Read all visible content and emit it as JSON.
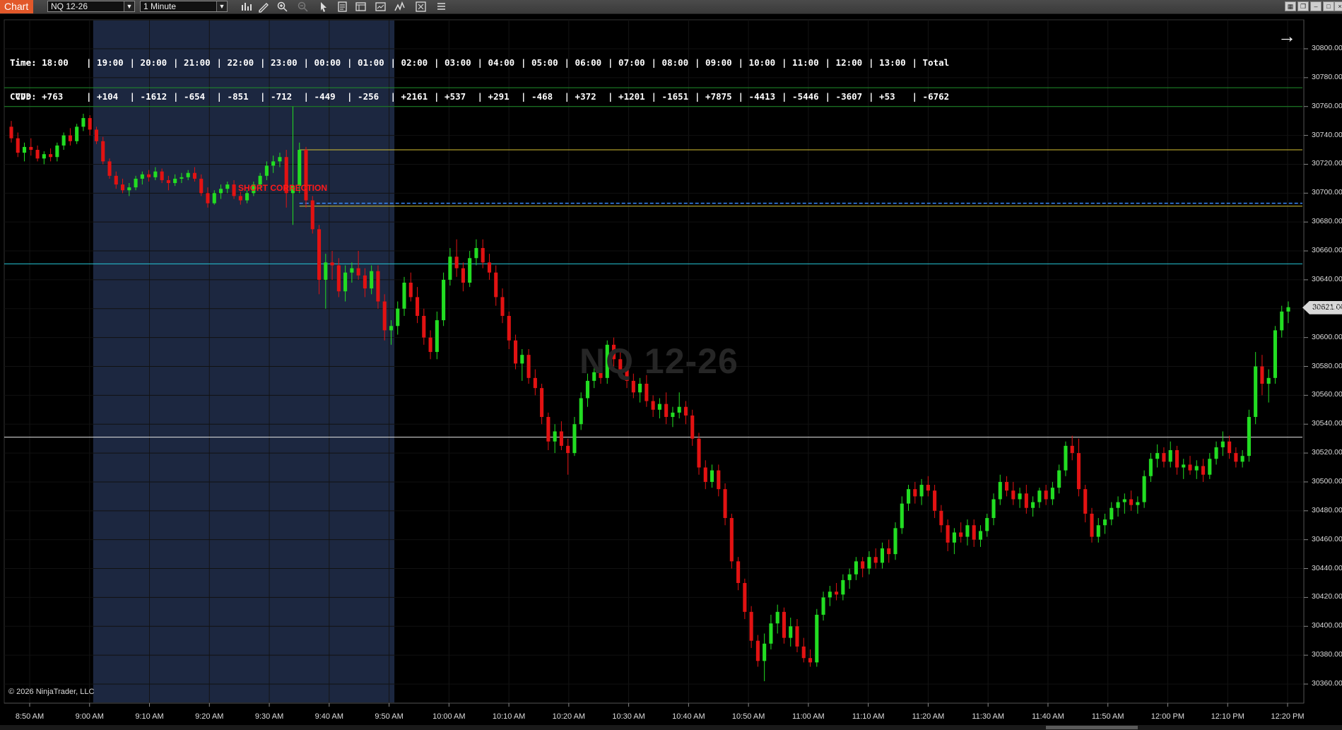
{
  "toolbar": {
    "tab_label": "Chart",
    "instrument": "NQ 12-26",
    "interval": "1 Minute",
    "icons": [
      "bar-type-icon",
      "pencil-icon",
      "zoom-in-icon",
      "zoom-out-icon",
      "pointer-icon",
      "data-box-icon",
      "properties-icon",
      "strategy-icon",
      "indicator-icon",
      "templates-icon",
      "menu-icon"
    ],
    "window_buttons": [
      "tile-icon",
      "restore-icon",
      "minimize-icon",
      "maximize-icon",
      "close-icon"
    ]
  },
  "cvd_table": {
    "time_label": "Time:",
    "cvd_label": "CVD:",
    "times": [
      "18:00",
      "19:00",
      "20:00",
      "21:00",
      "22:00",
      "23:00",
      "00:00",
      "01:00",
      "02:00",
      "03:00",
      "04:00",
      "05:00",
      "06:00",
      "07:00",
      "08:00",
      "09:00",
      "10:00",
      "11:00",
      "12:00",
      "13:00",
      "Total"
    ],
    "values": [
      "+763",
      "+104",
      "-1612",
      "-654",
      "-851",
      "-712",
      "-449",
      "-256",
      "+2161",
      "+537",
      "+291",
      "-468",
      "+372",
      "+1201",
      "-1651",
      "+7875",
      "-4413",
      "-5446",
      "-3607",
      "+53",
      "-6762"
    ]
  },
  "watermark": "NQ 12-26",
  "signal_label": "SHORT CORRECTION",
  "copyright": "© 2026 NinjaTrader, LLC",
  "last_price": "30621.00",
  "colors": {
    "up": "#22dd22",
    "down": "#e21212",
    "session_shade": "#1c2740",
    "bg": "#000000"
  },
  "chart_data": {
    "type": "candlestick",
    "instrument": "NQ 12-26",
    "interval": "1 Minute",
    "ylim": [
      30350,
      30810
    ],
    "y_ticks": [
      "30800.00",
      "30780.00",
      "30760.00",
      "30740.00",
      "30720.00",
      "30700.00",
      "30680.00",
      "30660.00",
      "30640.00",
      "30620.00",
      "30600.00",
      "30580.00",
      "30560.00",
      "30540.00",
      "30520.00",
      "30500.00",
      "30480.00",
      "30460.00",
      "30440.00",
      "30420.00",
      "30400.00",
      "30380.00",
      "30360.00"
    ],
    "x_ticks": [
      "8:50 AM",
      "9:00 AM",
      "9:10 AM",
      "9:20 AM",
      "9:30 AM",
      "9:40 AM",
      "9:50 AM",
      "10:00 AM",
      "10:10 AM",
      "10:20 AM",
      "10:30 AM",
      "10:40 AM",
      "10:50 AM",
      "11:00 AM",
      "11:10 AM",
      "11:20 AM",
      "11:30 AM",
      "11:40 AM",
      "11:50 AM",
      "12:00 PM",
      "12:10 PM",
      "12:20 PM"
    ],
    "horizontal_lines": [
      {
        "price": 30773,
        "color": "#1f8f2a",
        "style": "solid"
      },
      {
        "price": 30760,
        "color": "#1f8f2a",
        "style": "solid"
      },
      {
        "price": 30730,
        "color": "#d6c234",
        "style": "solid"
      },
      {
        "price": 30693,
        "color": "#3a8cff",
        "style": "dashed"
      },
      {
        "price": 30691,
        "color": "#d6c234",
        "style": "solid"
      },
      {
        "price": 30651,
        "color": "#26c6d6",
        "style": "solid"
      },
      {
        "price": 30531,
        "color": "#e6e6e6",
        "style": "solid"
      }
    ],
    "session_shade": {
      "from_bar": 13,
      "to_bar": 58
    },
    "candles": [
      [
        30746,
        30750,
        30735,
        30738
      ],
      [
        30738,
        30742,
        30725,
        30728
      ],
      [
        30728,
        30735,
        30722,
        30732
      ],
      [
        30732,
        30738,
        30726,
        30730
      ],
      [
        30730,
        30733,
        30722,
        30724
      ],
      [
        30724,
        30729,
        30720,
        30727
      ],
      [
        30727,
        30731,
        30722,
        30725
      ],
      [
        30725,
        30735,
        30722,
        30733
      ],
      [
        30733,
        30742,
        30730,
        30740
      ],
      [
        30740,
        30745,
        30733,
        30736
      ],
      [
        30736,
        30748,
        30734,
        30746
      ],
      [
        30746,
        30755,
        30743,
        30752
      ],
      [
        30752,
        30754,
        30740,
        30744
      ],
      [
        30744,
        30746,
        30734,
        30736
      ],
      [
        30736,
        30739,
        30720,
        30722
      ],
      [
        30722,
        30724,
        30710,
        30712
      ],
      [
        30712,
        30715,
        30703,
        30706
      ],
      [
        30706,
        30710,
        30700,
        30702
      ],
      [
        30702,
        30707,
        30698,
        30704
      ],
      [
        30704,
        30712,
        30702,
        30710
      ],
      [
        30710,
        30715,
        30706,
        30713
      ],
      [
        30713,
        30716,
        30708,
        30711
      ],
      [
        30711,
        30718,
        30709,
        30715
      ],
      [
        30715,
        30717,
        30707,
        30709
      ],
      [
        30709,
        30712,
        30702,
        30707
      ],
      [
        30707,
        30713,
        30705,
        30710
      ],
      [
        30710,
        30714,
        30707,
        30711
      ],
      [
        30711,
        30716,
        30709,
        30714
      ],
      [
        30714,
        30718,
        30708,
        30710
      ],
      [
        30710,
        30713,
        30698,
        30700
      ],
      [
        30700,
        30704,
        30690,
        30693
      ],
      [
        30693,
        30702,
        30692,
        30700
      ],
      [
        30700,
        30706,
        30696,
        30703
      ],
      [
        30703,
        30708,
        30700,
        30706
      ],
      [
        30706,
        30709,
        30696,
        30698
      ],
      [
        30698,
        30701,
        30692,
        30695
      ],
      [
        30695,
        30702,
        30693,
        30700
      ],
      [
        30700,
        30708,
        30698,
        30706
      ],
      [
        30706,
        30714,
        30703,
        30712
      ],
      [
        30712,
        30722,
        30709,
        30719
      ],
      [
        30719,
        30726,
        30714,
        30722
      ],
      [
        30722,
        30728,
        30718,
        30725
      ],
      [
        30725,
        30730,
        30690,
        30700
      ],
      [
        30700,
        30760,
        30678,
        30705
      ],
      [
        30705,
        30735,
        30700,
        30730
      ],
      [
        30730,
        30732,
        30690,
        30695
      ],
      [
        30695,
        30698,
        30672,
        30675
      ],
      [
        30675,
        30678,
        30630,
        30640
      ],
      [
        30640,
        30658,
        30620,
        30652
      ],
      [
        30652,
        30660,
        30640,
        30650
      ],
      [
        30650,
        30655,
        30628,
        30632
      ],
      [
        30632,
        30650,
        30625,
        30645
      ],
      [
        30645,
        30652,
        30638,
        30648
      ],
      [
        30648,
        30660,
        30640,
        30643
      ],
      [
        30643,
        30648,
        30628,
        30634
      ],
      [
        30634,
        30650,
        30630,
        30646
      ],
      [
        30646,
        30650,
        30620,
        30625
      ],
      [
        30625,
        30630,
        30598,
        30605
      ],
      [
        30605,
        30612,
        30595,
        30608
      ],
      [
        30608,
        30625,
        30602,
        30620
      ],
      [
        30620,
        30642,
        30615,
        30638
      ],
      [
        30638,
        30645,
        30625,
        30628
      ],
      [
        30628,
        30635,
        30610,
        30615
      ],
      [
        30615,
        30620,
        30595,
        30600
      ],
      [
        30600,
        30605,
        30585,
        30590
      ],
      [
        30590,
        30618,
        30585,
        30612
      ],
      [
        30612,
        30645,
        30608,
        30640
      ],
      [
        30640,
        30662,
        30636,
        30656
      ],
      [
        30656,
        30668,
        30642,
        30648
      ],
      [
        30648,
        30652,
        30632,
        30638
      ],
      [
        30638,
        30660,
        30635,
        30655
      ],
      [
        30655,
        30668,
        30650,
        30662
      ],
      [
        30662,
        30668,
        30648,
        30652
      ],
      [
        30652,
        30658,
        30640,
        30645
      ],
      [
        30645,
        30650,
        30622,
        30628
      ],
      [
        30628,
        30634,
        30610,
        30615
      ],
      [
        30615,
        30618,
        30592,
        30598
      ],
      [
        30598,
        30602,
        30578,
        30582
      ],
      [
        30582,
        30592,
        30570,
        30588
      ],
      [
        30588,
        30592,
        30568,
        30572
      ],
      [
        30572,
        30578,
        30560,
        30565
      ],
      [
        30565,
        30568,
        30540,
        30545
      ],
      [
        30545,
        30548,
        30522,
        30528
      ],
      [
        30528,
        30540,
        30520,
        30535
      ],
      [
        30535,
        30542,
        30522,
        30525
      ],
      [
        30525,
        30530,
        30505,
        30520
      ],
      [
        30520,
        30545,
        30518,
        30540
      ],
      [
        30540,
        30562,
        30536,
        30558
      ],
      [
        30558,
        30575,
        30552,
        30570
      ],
      [
        30570,
        30582,
        30565,
        30576
      ],
      [
        30576,
        30585,
        30568,
        30572
      ],
      [
        30572,
        30598,
        30568,
        30595
      ],
      [
        30595,
        30600,
        30580,
        30585
      ],
      [
        30585,
        30590,
        30572,
        30578
      ],
      [
        30578,
        30582,
        30565,
        30570
      ],
      [
        30570,
        30575,
        30558,
        30562
      ],
      [
        30562,
        30572,
        30555,
        30568
      ],
      [
        30568,
        30574,
        30552,
        30556
      ],
      [
        30556,
        30560,
        30545,
        30550
      ],
      [
        30550,
        30558,
        30544,
        30554
      ],
      [
        30554,
        30562,
        30540,
        30545
      ],
      [
        30545,
        30552,
        30538,
        30548
      ],
      [
        30548,
        30562,
        30544,
        30552
      ],
      [
        30552,
        30556,
        30540,
        30546
      ],
      [
        30546,
        30550,
        30525,
        30530
      ],
      [
        30530,
        30534,
        30505,
        30510
      ],
      [
        30510,
        30515,
        30495,
        30500
      ],
      [
        30500,
        30512,
        30496,
        30508
      ],
      [
        30508,
        30512,
        30490,
        30495
      ],
      [
        30495,
        30499,
        30470,
        30475
      ],
      [
        30475,
        30478,
        30440,
        30445
      ],
      [
        30445,
        30448,
        30425,
        30430
      ],
      [
        30430,
        30433,
        30405,
        30410
      ],
      [
        30410,
        30414,
        30385,
        30390
      ],
      [
        30390,
        30394,
        30372,
        30376
      ],
      [
        30376,
        30395,
        30362,
        30388
      ],
      [
        30388,
        30408,
        30384,
        30402
      ],
      [
        30402,
        30415,
        30395,
        30410
      ],
      [
        30410,
        30413,
        30388,
        30392
      ],
      [
        30392,
        30406,
        30386,
        30400
      ],
      [
        30400,
        30405,
        30382,
        30386
      ],
      [
        30386,
        30392,
        30375,
        30378
      ],
      [
        30378,
        30384,
        30372,
        30375
      ],
      [
        30375,
        30412,
        30372,
        30408
      ],
      [
        30408,
        30424,
        30404,
        30420
      ],
      [
        30420,
        30428,
        30414,
        30424
      ],
      [
        30424,
        30430,
        30418,
        30422
      ],
      [
        30422,
        30436,
        30418,
        30432
      ],
      [
        30432,
        30440,
        30426,
        30436
      ],
      [
        30436,
        30448,
        30432,
        30445
      ],
      [
        30445,
        30448,
        30434,
        30440
      ],
      [
        30440,
        30452,
        30436,
        30448
      ],
      [
        30448,
        30454,
        30440,
        30444
      ],
      [
        30444,
        30458,
        30440,
        30454
      ],
      [
        30454,
        30460,
        30444,
        30450
      ],
      [
        30450,
        30472,
        30446,
        30468
      ],
      [
        30468,
        30490,
        30464,
        30485
      ],
      [
        30485,
        30498,
        30480,
        30495
      ],
      [
        30495,
        30500,
        30485,
        30490
      ],
      [
        30490,
        30502,
        30484,
        30498
      ],
      [
        30498,
        30504,
        30490,
        30494
      ],
      [
        30494,
        30498,
        30475,
        30480
      ],
      [
        30480,
        30484,
        30465,
        30470
      ],
      [
        30470,
        30474,
        30452,
        30458
      ],
      [
        30458,
        30468,
        30450,
        30465
      ],
      [
        30465,
        30472,
        30458,
        30462
      ],
      [
        30462,
        30474,
        30456,
        30470
      ],
      [
        30470,
        30474,
        30455,
        30460
      ],
      [
        30460,
        30470,
        30455,
        30466
      ],
      [
        30466,
        30478,
        30462,
        30475
      ],
      [
        30475,
        30492,
        30470,
        30488
      ],
      [
        30488,
        30505,
        30484,
        30500
      ],
      [
        30500,
        30504,
        30490,
        30494
      ],
      [
        30494,
        30500,
        30484,
        30488
      ],
      [
        30488,
        30496,
        30482,
        30492
      ],
      [
        30492,
        30498,
        30478,
        30482
      ],
      [
        30482,
        30490,
        30476,
        30486
      ],
      [
        30486,
        30496,
        30482,
        30494
      ],
      [
        30494,
        30498,
        30484,
        30488
      ],
      [
        30488,
        30500,
        30484,
        30496
      ],
      [
        30496,
        30512,
        30492,
        30508
      ],
      [
        30508,
        30528,
        30504,
        30525
      ],
      [
        30525,
        30532,
        30515,
        30520
      ],
      [
        30520,
        30530,
        30490,
        30495
      ],
      [
        30495,
        30498,
        30472,
        30478
      ],
      [
        30478,
        30482,
        30458,
        30462
      ],
      [
        30462,
        30475,
        30458,
        30470
      ],
      [
        30470,
        30478,
        30464,
        30474
      ],
      [
        30474,
        30486,
        30470,
        30482
      ],
      [
        30482,
        30490,
        30476,
        30486
      ],
      [
        30486,
        30492,
        30478,
        30488
      ],
      [
        30488,
        30494,
        30480,
        30484
      ],
      [
        30484,
        30490,
        30478,
        30486
      ],
      [
        30486,
        30508,
        30482,
        30504
      ],
      [
        30504,
        30520,
        30500,
        30516
      ],
      [
        30516,
        30526,
        30510,
        30520
      ],
      [
        30520,
        30524,
        30510,
        30514
      ],
      [
        30514,
        30528,
        30510,
        30522
      ],
      [
        30522,
        30525,
        30505,
        30510
      ],
      [
        30510,
        30516,
        30502,
        30512
      ],
      [
        30512,
        30518,
        30505,
        30508
      ],
      [
        30508,
        30515,
        30502,
        30511
      ],
      [
        30511,
        30516,
        30500,
        30505
      ],
      [
        30505,
        30520,
        30502,
        30516
      ],
      [
        30516,
        30528,
        30512,
        30524
      ],
      [
        30524,
        30535,
        30518,
        30528
      ],
      [
        30528,
        30532,
        30516,
        30520
      ],
      [
        30520,
        30524,
        30510,
        30514
      ],
      [
        30514,
        30522,
        30510,
        30518
      ],
      [
        30518,
        30550,
        30514,
        30545
      ],
      [
        30545,
        30590,
        30540,
        30580
      ],
      [
        30580,
        30588,
        30560,
        30568
      ],
      [
        30568,
        30578,
        30555,
        30572
      ],
      [
        30572,
        30608,
        30568,
        30605
      ],
      [
        30605,
        30622,
        30600,
        30618
      ],
      [
        30618,
        30625,
        30610,
        30621
      ]
    ]
  }
}
